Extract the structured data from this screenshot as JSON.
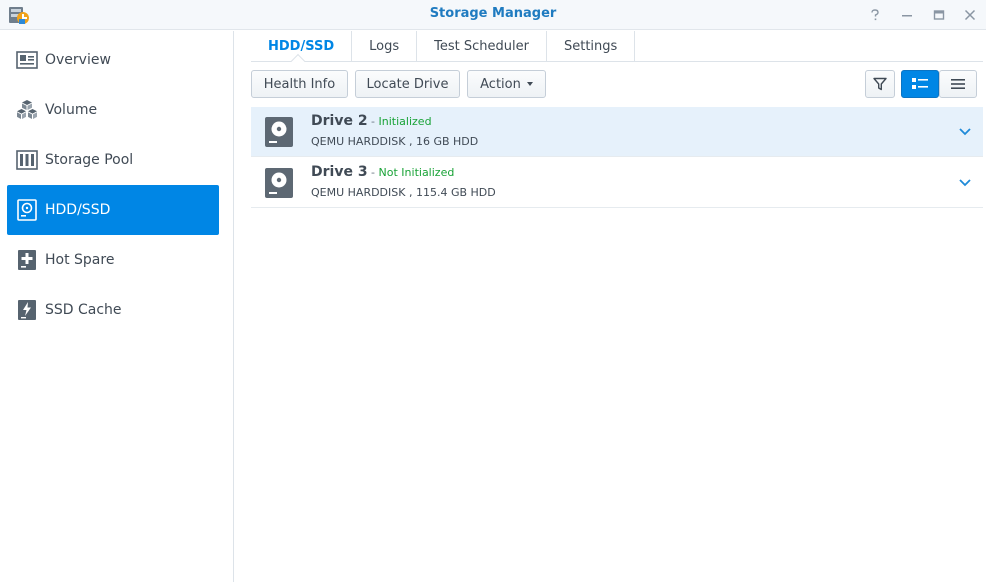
{
  "window": {
    "title": "Storage Manager",
    "controls": [
      "help-icon",
      "minimize-icon",
      "maximize-icon",
      "close-icon"
    ]
  },
  "sidebar": {
    "items": [
      {
        "label": "Overview",
        "icon": "overview-icon"
      },
      {
        "label": "Volume",
        "icon": "volume-icon"
      },
      {
        "label": "Storage Pool",
        "icon": "storage-pool-icon"
      },
      {
        "label": "HDD/SSD",
        "icon": "hdd-icon",
        "active": true
      },
      {
        "label": "Hot Spare",
        "icon": "hot-spare-icon"
      },
      {
        "label": "SSD Cache",
        "icon": "ssd-cache-icon"
      }
    ]
  },
  "tabs": [
    {
      "label": "HDD/SSD",
      "active": true
    },
    {
      "label": "Logs"
    },
    {
      "label": "Test Scheduler"
    },
    {
      "label": "Settings"
    }
  ],
  "toolbar": {
    "health_info": "Health Info",
    "locate_drive": "Locate Drive",
    "action": "Action"
  },
  "drives": [
    {
      "name": "Drive 2",
      "sep": " - ",
      "status": "Initialized",
      "desc": "QEMU HARDDISK , 16 GB HDD",
      "selected": true
    },
    {
      "name": "Drive 3",
      "sep": " - ",
      "status": "Not Initialized",
      "desc": "QEMU HARDDISK , 115.4 GB HDD",
      "selected": false
    }
  ],
  "colors": {
    "accent": "#0086e5",
    "status_ok": "#19a337",
    "selected_row": "#e6f1fb"
  }
}
